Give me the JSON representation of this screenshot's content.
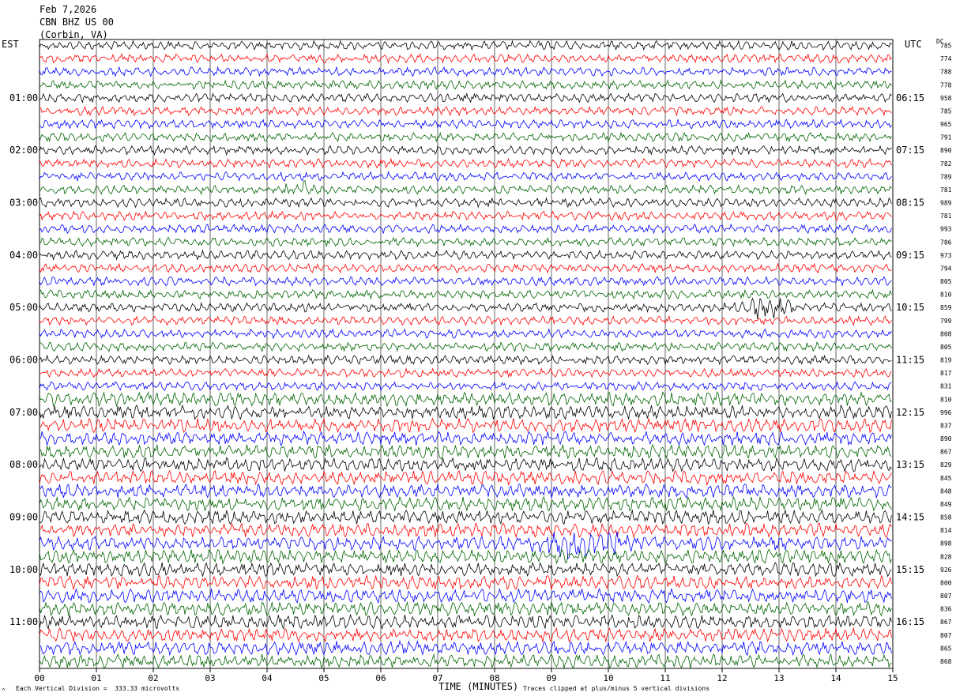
{
  "header": {
    "date": "Feb 7,2026",
    "station": "CBN BHZ US 00",
    "location": "(Corbin, VA)"
  },
  "left_axis_label": "EST",
  "right_axis_label": "UTC",
  "dc_label": "DC",
  "footer": {
    "vertical_division": "Each Vertical Division =  333.33 microvolts",
    "clip_note": "Traces clipped at plus/minus 5 vertical divisions",
    "corner_mark": "^"
  },
  "chart_data": {
    "type": "line",
    "title": "",
    "xlabel": "TIME (MINUTES)",
    "ylabel": "",
    "xlim": [
      0,
      15
    ],
    "x_ticks": [
      "00",
      "01",
      "02",
      "03",
      "04",
      "05",
      "06",
      "07",
      "08",
      "09",
      "10",
      "11",
      "12",
      "13",
      "14",
      "15"
    ],
    "trace_count": 48,
    "trace_colors": [
      "#000000",
      "#ff0000",
      "#0000ff",
      "#006400"
    ],
    "left_time_labels": [
      {
        "row": 4,
        "label": "01:00"
      },
      {
        "row": 8,
        "label": "02:00"
      },
      {
        "row": 12,
        "label": "03:00"
      },
      {
        "row": 16,
        "label": "04:00"
      },
      {
        "row": 20,
        "label": "05:00"
      },
      {
        "row": 24,
        "label": "06:00"
      },
      {
        "row": 28,
        "label": "07:00"
      },
      {
        "row": 32,
        "label": "08:00"
      },
      {
        "row": 36,
        "label": "09:00"
      },
      {
        "row": 40,
        "label": "10:00"
      },
      {
        "row": 44,
        "label": "11:00"
      }
    ],
    "right_time_labels": [
      {
        "row": 4,
        "label": "06:15"
      },
      {
        "row": 8,
        "label": "07:15"
      },
      {
        "row": 12,
        "label": "08:15"
      },
      {
        "row": 16,
        "label": "09:15"
      },
      {
        "row": 20,
        "label": "10:15"
      },
      {
        "row": 24,
        "label": "11:15"
      },
      {
        "row": 28,
        "label": "12:15"
      },
      {
        "row": 32,
        "label": "13:15"
      },
      {
        "row": 36,
        "label": "14:15"
      },
      {
        "row": 40,
        "label": "15:15"
      },
      {
        "row": 44,
        "label": "16:15"
      }
    ],
    "dc_values": [
      "785",
      "774",
      "788",
      "778",
      "958",
      "785",
      "965",
      "791",
      "890",
      "782",
      "789",
      "781",
      "989",
      "781",
      "993",
      "786",
      "973",
      "794",
      "805",
      "810",
      "859",
      "799",
      "808",
      "805",
      "819",
      "817",
      "831",
      "810",
      "996",
      "837",
      "890",
      "867",
      "829",
      "845",
      "848",
      "849",
      "858",
      "814",
      "898",
      "828",
      "926",
      "800",
      "807",
      "836",
      "867",
      "807",
      "865",
      "868"
    ]
  }
}
